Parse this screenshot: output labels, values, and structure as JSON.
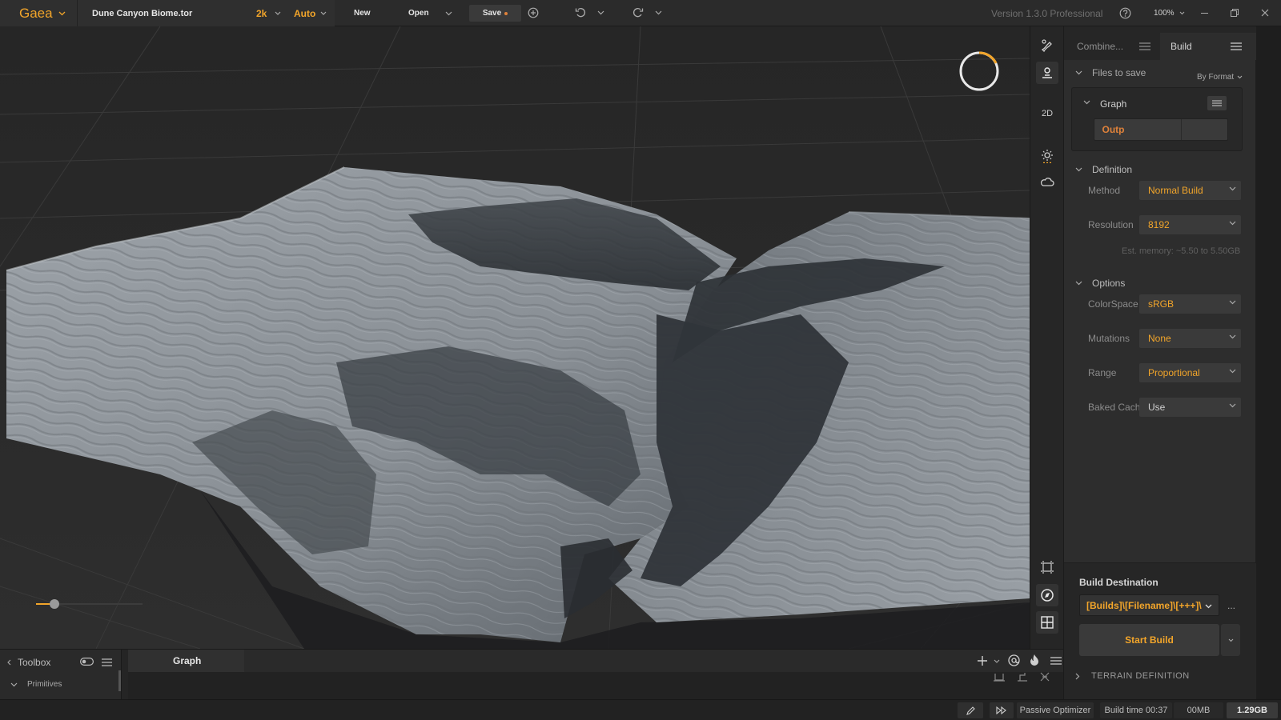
{
  "topbar": {
    "app_name": "Gaea",
    "file_name": "Dune Canyon Biome.tor",
    "resolution": "2k",
    "quality": "Auto",
    "new_label": "New",
    "open_label": "Open",
    "save_label": "Save",
    "version": "Version 1.3.0 Professional",
    "zoom": "100%"
  },
  "vtools": {
    "mode_2d": "2D"
  },
  "right_panel": {
    "tab_combine": "Combine...",
    "tab_build": "Build",
    "files_to_save": "Files to save",
    "by_format": "By Format",
    "graph_label": "Graph",
    "output_tag": "Outp",
    "definition": {
      "title": "Definition",
      "method_label": "Method",
      "method_value": "Normal Build",
      "resolution_label": "Resolution",
      "resolution_value": "8192",
      "est_memory": "Est. memory: ~5.50 to 5.50GB"
    },
    "options": {
      "title": "Options",
      "colorspace_label": "ColorSpace",
      "colorspace_value": "sRGB",
      "mutations_label": "Mutations",
      "mutations_value": "None",
      "range_label": "Range",
      "range_value": "Proportional",
      "baked_label": "Baked Cach",
      "baked_value": "Use"
    },
    "build_destination_label": "Build Destination",
    "build_destination_value": "[Builds]\\[Filename]\\[+++]\\",
    "ellipsis": "...",
    "start_build": "Start Build",
    "terrain_definition": "TERRAIN DEFINITION"
  },
  "bottom": {
    "toolbox_label": "Toolbox",
    "primitives_label": "Primitives",
    "graph_tab": "Graph"
  },
  "statusbar": {
    "passive_optimizer": "Passive Optimizer",
    "build_time": "Build time 00:37",
    "memory1": "00MB",
    "memory2": "1.29GB"
  },
  "colors": {
    "accent": "#f2a52a",
    "output_tag": "#e0823a"
  }
}
